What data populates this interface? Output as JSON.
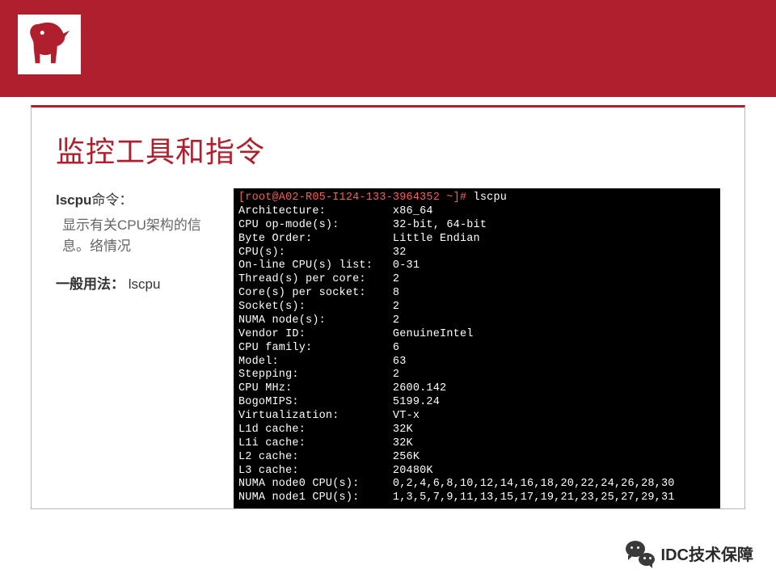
{
  "header": {
    "logo": "jd-dog"
  },
  "card": {
    "title": "监控工具和指令",
    "command": {
      "name": "lscpu",
      "suffix": "命令："
    },
    "description": "显示有关CPU架构的信息。络情况",
    "usage": {
      "label": "一般用法：",
      "value": " lscpu"
    }
  },
  "terminal": {
    "prompt": "[root@A02-R05-I124-133-3964352 ~]# ",
    "command": "lscpu",
    "rows": [
      {
        "k": "Architecture:",
        "v": "x86_64"
      },
      {
        "k": "CPU op-mode(s):",
        "v": "32-bit, 64-bit"
      },
      {
        "k": "Byte Order:",
        "v": "Little Endian"
      },
      {
        "k": "CPU(s):",
        "v": "32"
      },
      {
        "k": "On-line CPU(s) list:",
        "v": "0-31"
      },
      {
        "k": "Thread(s) per core:",
        "v": "2"
      },
      {
        "k": "Core(s) per socket:",
        "v": "8"
      },
      {
        "k": "Socket(s):",
        "v": "2"
      },
      {
        "k": "NUMA node(s):",
        "v": "2"
      },
      {
        "k": "Vendor ID:",
        "v": "GenuineIntel"
      },
      {
        "k": "CPU family:",
        "v": "6"
      },
      {
        "k": "Model:",
        "v": "63"
      },
      {
        "k": "Stepping:",
        "v": "2"
      },
      {
        "k": "CPU MHz:",
        "v": "2600.142"
      },
      {
        "k": "BogoMIPS:",
        "v": "5199.24"
      },
      {
        "k": "Virtualization:",
        "v": "VT-x"
      },
      {
        "k": "L1d cache:",
        "v": "32K"
      },
      {
        "k": "L1i cache:",
        "v": "32K"
      },
      {
        "k": "L2 cache:",
        "v": "256K"
      },
      {
        "k": "L3 cache:",
        "v": "20480K"
      },
      {
        "k": "NUMA node0 CPU(s):",
        "v": "0,2,4,6,8,10,12,14,16,18,20,22,24,26,28,30"
      },
      {
        "k": "NUMA node1 CPU(s):",
        "v": "1,3,5,7,9,11,13,15,17,19,21,23,25,27,29,31"
      }
    ]
  },
  "footer": {
    "icon": "wechat",
    "text": "IDC技术保障"
  },
  "meta": {
    "label_col_width": 23
  }
}
